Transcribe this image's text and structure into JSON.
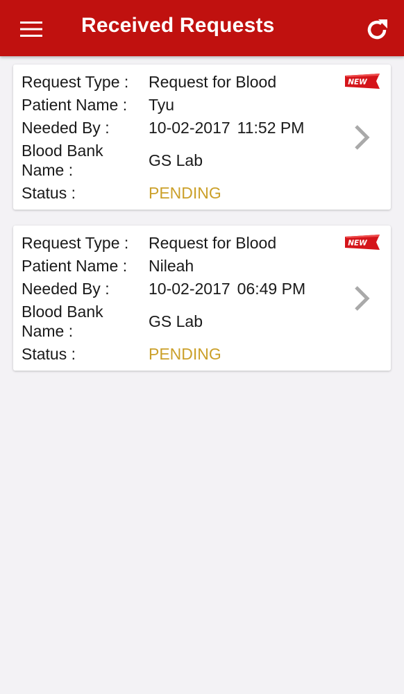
{
  "app_bar": {
    "title": "Received Requests",
    "menu_icon": "hamburger-menu-icon",
    "refresh_icon": "refresh-icon",
    "color": "#c0110f"
  },
  "labels": {
    "request_type": "Request Type :",
    "patient_name": "Patient Name :",
    "needed_by": "Needed By :",
    "blood_bank_line1": "Blood Bank",
    "blood_bank_line2": "Name :",
    "status": "Status :"
  },
  "badge_text": "NEW",
  "status_color": "#cba02a",
  "requests": [
    {
      "request_type": "Request for Blood",
      "patient_name": "Tyu",
      "needed_date": "10-02-2017",
      "needed_time": "11:52 PM",
      "blood_bank_name": "GS Lab",
      "status": "PENDING"
    },
    {
      "request_type": "Request for Blood",
      "patient_name": "Nileah",
      "needed_date": "10-02-2017",
      "needed_time": "06:49 PM",
      "blood_bank_name": "GS Lab",
      "status": "PENDING"
    }
  ]
}
